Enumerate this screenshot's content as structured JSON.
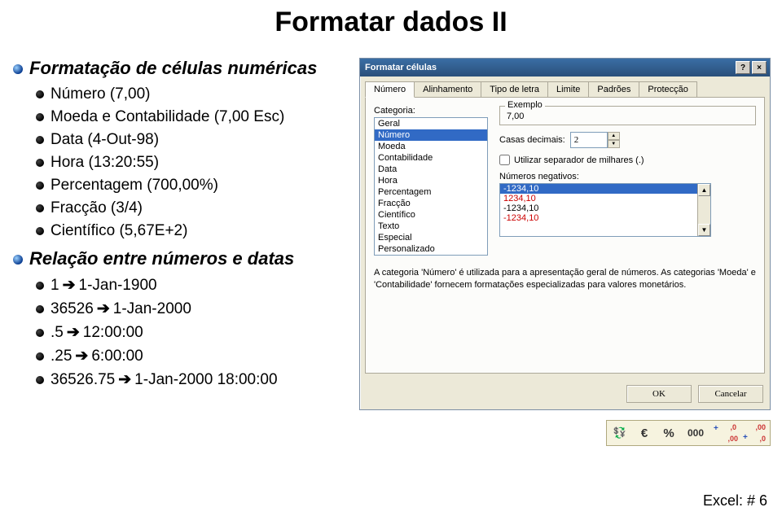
{
  "page": {
    "title": "Formatar dados II"
  },
  "outline": {
    "sec1": {
      "title": "Formatação de células numéricas",
      "items": [
        "Número (7,00)",
        "Moeda e Contabilidade (7,00 Esc)",
        "Data (4-Out-98)",
        "Hora (13:20:55)",
        "Percentagem (700,00%)",
        "Fracção (3/4)",
        "Científico (5,67E+2)"
      ]
    },
    "sec2": {
      "title": "Relação entre números e datas",
      "rows": [
        {
          "left": "1",
          "right": "1-Jan-1900"
        },
        {
          "left": "36526",
          "right": "1-Jan-2000"
        },
        {
          "left": ".5",
          "right": "12:00:00"
        },
        {
          "left": ".25",
          "right": "6:00:00"
        },
        {
          "left": "36526.75",
          "right": "1-Jan-2000 18:00:00"
        }
      ]
    }
  },
  "dialog": {
    "title": "Formatar células",
    "help_icon": "?",
    "close_icon": "×",
    "tabs": [
      "Número",
      "Alinhamento",
      "Tipo de letra",
      "Limite",
      "Padrões",
      "Protecção"
    ],
    "active_tab": "Número",
    "category_label": "Categoria:",
    "categories": [
      "Geral",
      "Número",
      "Moeda",
      "Contabilidade",
      "Data",
      "Hora",
      "Percentagem",
      "Fracção",
      "Científico",
      "Texto",
      "Especial",
      "Personalizado"
    ],
    "category_selected": "Número",
    "example_group": "Exemplo",
    "example_value": "7,00",
    "decimals_label": "Casas decimais:",
    "decimals_value": "2",
    "thousands_label": "Utilizar separador de milhares (.)",
    "negatives_label": "Números negativos:",
    "negatives": [
      {
        "text": "-1234,10",
        "red": true,
        "selected": true
      },
      {
        "text": "1234,10",
        "red": true
      },
      {
        "text": "-1234,10",
        "red": false
      },
      {
        "text": "-1234,10",
        "red": true
      }
    ],
    "description": "A categoria 'Número' é utilizada para a apresentação geral de números. As categorias 'Moeda' e 'Contabilidade' fornecem formatações especializadas para valores monetários.",
    "ok_label": "OK",
    "cancel_label": "Cancelar"
  },
  "toolbar": {
    "buttons": [
      {
        "name": "currency-style-icon",
        "glyph": "₪"
      },
      {
        "name": "euro-icon",
        "glyph": "€"
      },
      {
        "name": "percent-icon",
        "glyph": "%"
      },
      {
        "name": "comma-style-icon",
        "glyph": "000"
      },
      {
        "name": "increase-decimal-icon",
        "glyph": "+,0"
      },
      {
        "name": "decrease-decimal-icon",
        "glyph": "-,00"
      }
    ]
  },
  "footer": {
    "text": "Excel: # 6"
  }
}
